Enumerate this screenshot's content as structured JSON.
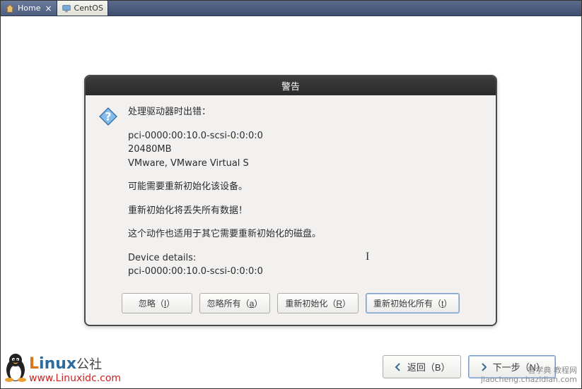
{
  "tabs": [
    {
      "label": "Home",
      "active": false
    },
    {
      "label": "CentOS",
      "active": true
    }
  ],
  "dialog": {
    "title": "警告",
    "line1": "处理驱动器时出错：",
    "device_path": "pci-0000:00:10.0-scsi-0:0:0:0",
    "size": "20480MB",
    "model": "VMware, VMware Virtual S",
    "line2": "可能需要重新初始化该设备。",
    "line3": "重新初始化将丢失所有数据！",
    "line4": "这个动作也适用于其它需要重新初始化的磁盘。",
    "details_label": "Device details:",
    "details_path": "pci-0000:00:10.0-scsi-0:0:0:0",
    "buttons": {
      "ignore": {
        "label": "忽略",
        "key": "I"
      },
      "ignore_all": {
        "label": "忽略所有",
        "key": "a"
      },
      "reinit": {
        "label": "重新初始化",
        "key": "R"
      },
      "reinit_all": {
        "label": "重新初始化所有",
        "key": "t"
      }
    }
  },
  "footer": {
    "back": {
      "label": "返回",
      "key": "B"
    },
    "next": {
      "label": "下一步",
      "key": "N"
    }
  },
  "watermark": {
    "brand": "Linux公社",
    "url": "www.Linuxidc.com",
    "right1": "智学典 教程网",
    "right2": "jiaocheng.chazidian.com"
  }
}
